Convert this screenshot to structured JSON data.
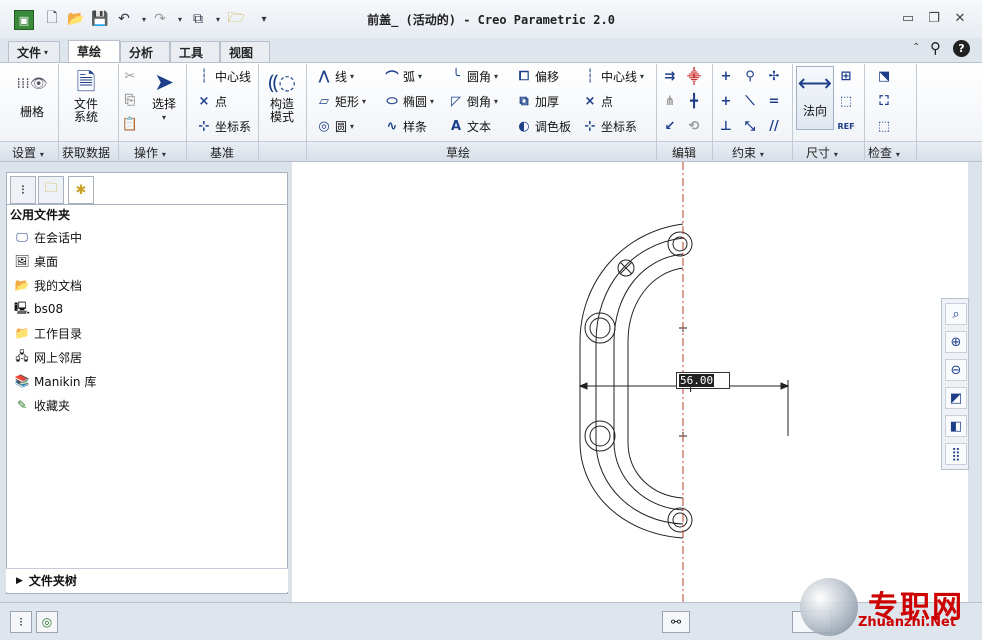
{
  "window": {
    "title": "前盖_ (活动的) - Creo Parametric 2.0"
  },
  "menu_tabs": [
    {
      "label": "文件",
      "dropdown": true
    },
    {
      "label": "草绘",
      "active": true
    },
    {
      "label": "分析"
    },
    {
      "label": "工具"
    },
    {
      "label": "视图"
    }
  ],
  "ribbon": {
    "setup": {
      "grid": "栅格",
      "group": "设置"
    },
    "get_data": {
      "file_system_l1": "文件",
      "file_system_l2": "系统",
      "group": "获取数据"
    },
    "operations": {
      "select": "选择",
      "group": "操作"
    },
    "datum": {
      "centerline": "中心线",
      "point": "点",
      "csys": "坐标系",
      "group": "基准"
    },
    "construction": {
      "label_l1": "构造",
      "label_l2": "模式"
    },
    "sketch": {
      "line": "线",
      "rectangle": "矩形",
      "circle": "圆",
      "arc": "弧",
      "ellipse": "椭圆",
      "spline": "样条",
      "fillet": "圆角",
      "chamfer": "倒角",
      "text": "文本",
      "offset": "偏移",
      "thicken": "加厚",
      "palette": "调色板",
      "centerline": "中心线",
      "point": "点",
      "csys": "坐标系",
      "group": "草绘"
    },
    "edit": {
      "group": "编辑"
    },
    "constrain": {
      "group": "约束"
    },
    "dimension": {
      "normal": "法向",
      "group": "尺寸"
    },
    "inspect": {
      "group": "检查"
    }
  },
  "left_panel": {
    "header": "公用文件夹",
    "items": [
      "在会话中",
      "桌面",
      "我的文档",
      "bs08",
      "工作目录",
      "网上邻居",
      "Manikin 库",
      "收藏夹"
    ],
    "folder_tree": "文件夹树"
  },
  "canvas": {
    "dimension_value": "56.00"
  },
  "watermark": {
    "text": "专职网",
    "url": "Zhuanzhi.Net"
  },
  "colors": {
    "accent": "#1d3f8a",
    "centerline": "#c0392b",
    "watermark": "#cc0000"
  }
}
